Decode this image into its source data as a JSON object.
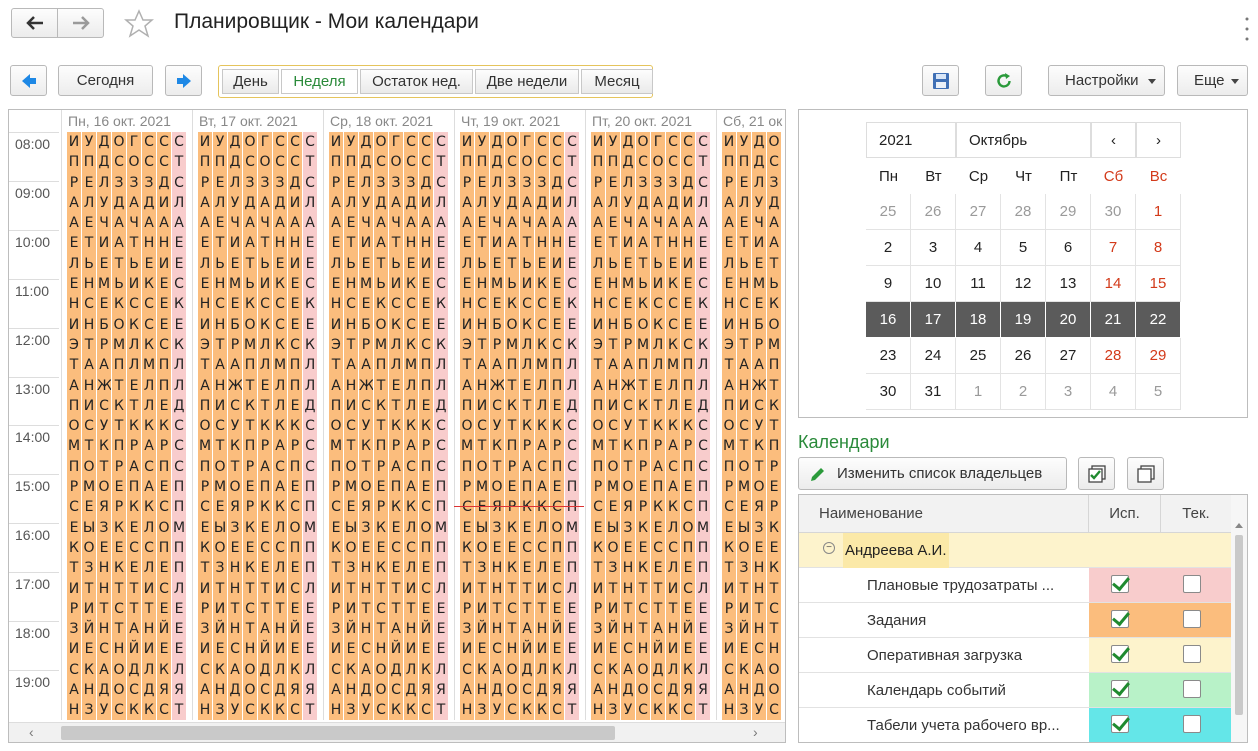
{
  "window": {
    "title": "Планировщик - Мои календари"
  },
  "toolbar": {
    "today": "Сегодня",
    "views": [
      "День",
      "Неделя",
      "Остаток нед.",
      "Две недели",
      "Месяц"
    ],
    "active_view": "Неделя",
    "settings": "Настройки",
    "more": "Еще"
  },
  "schedule": {
    "times": [
      "08:00",
      "09:00",
      "10:00",
      "11:00",
      "12:00",
      "13:00",
      "14:00",
      "15:00",
      "16:00",
      "17:00",
      "18:00",
      "19:00"
    ],
    "days": [
      "Пн, 16 окт. 2021",
      "Вт, 17 окт. 2021",
      "Ср, 18 окт. 2021",
      "Чт, 19 окт. 2021",
      "Пт, 20 окт. 2021",
      "Сб, 21 ок"
    ],
    "columns": [
      "ИПРААЕЛЕНИЭТАПОМПРСЕКТИРЗИСАНЧ",
      "УПЕЛЕТЬНСНТАНИСТОМЕЫОЗТИЙЕКНЗМ",
      "ДДЛУЧИЕМЕБРАЖСУКТОЯЗЕННТНСАДУК",
      "ОСЗДААТЬКОМПТКТПРЕРКЕКТСТНООСК",
      "ГОЗАЧТЬИСКЛЛЕТКРАПКЕСЕТТАЙДСК",
      "ССЗДАНЕКССКМЛЛКАСАКЛСЛИТНИЛДК",
      "ССДИАНИЕЕЕСППЕКРПЕСОПЕСЕЙЕКЯСК",
      "СТСЛАЕЕСКЕКЛЛДСССППМППЛЕЕЕЛЯТД"
    ],
    "col_colors": [
      "#fbbd7d",
      "#fbbd7d",
      "#fbbd7d",
      "#fbbd7d",
      "#fbbd7d",
      "#fbbd7d",
      "#fbbd7d",
      "#f8cccc"
    ]
  },
  "calendar": {
    "year": "2021",
    "month": "Октябрь",
    "weekdays": [
      "Пн",
      "Вт",
      "Ср",
      "Чт",
      "Пт",
      "Сб",
      "Вс"
    ],
    "days": [
      "25",
      "26",
      "27",
      "28",
      "29",
      "30",
      "1",
      "2",
      "3",
      "4",
      "5",
      "6",
      "7",
      "8",
      "9",
      "10",
      "11",
      "12",
      "13",
      "14",
      "15",
      "16",
      "17",
      "18",
      "19",
      "20",
      "21",
      "22",
      "23",
      "24",
      "25",
      "26",
      "27",
      "28",
      "29",
      "30",
      "31",
      "1",
      "2",
      "3",
      "4",
      "5"
    ]
  },
  "calendars": {
    "title": "Календари",
    "edit_owners": "Изменить список владельцев",
    "headers": {
      "name": "Наименование",
      "use": "Исп.",
      "current": "Тек."
    },
    "owner": "Андреева А.И.",
    "rows": [
      {
        "name": "Плановые трудозатраты ...",
        "use": true,
        "cur": false,
        "color": "#f8cccc"
      },
      {
        "name": "Задания",
        "use": true,
        "cur": false,
        "color": "#fbbd7d"
      },
      {
        "name": "Оперативная загрузка",
        "use": true,
        "cur": false,
        "color": "#fdf3cc"
      },
      {
        "name": "Календарь событий",
        "use": true,
        "cur": false,
        "color": "#b8f2c8"
      },
      {
        "name": "Табели учета рабочего вр...",
        "use": true,
        "cur": false,
        "color": "#64e6e8"
      }
    ]
  },
  "colors": {
    "accent": "#2a8a3a",
    "selected_week": "#5b5b5b",
    "weekend": "#d33a1a",
    "nav_blue": "#1e88e5"
  }
}
